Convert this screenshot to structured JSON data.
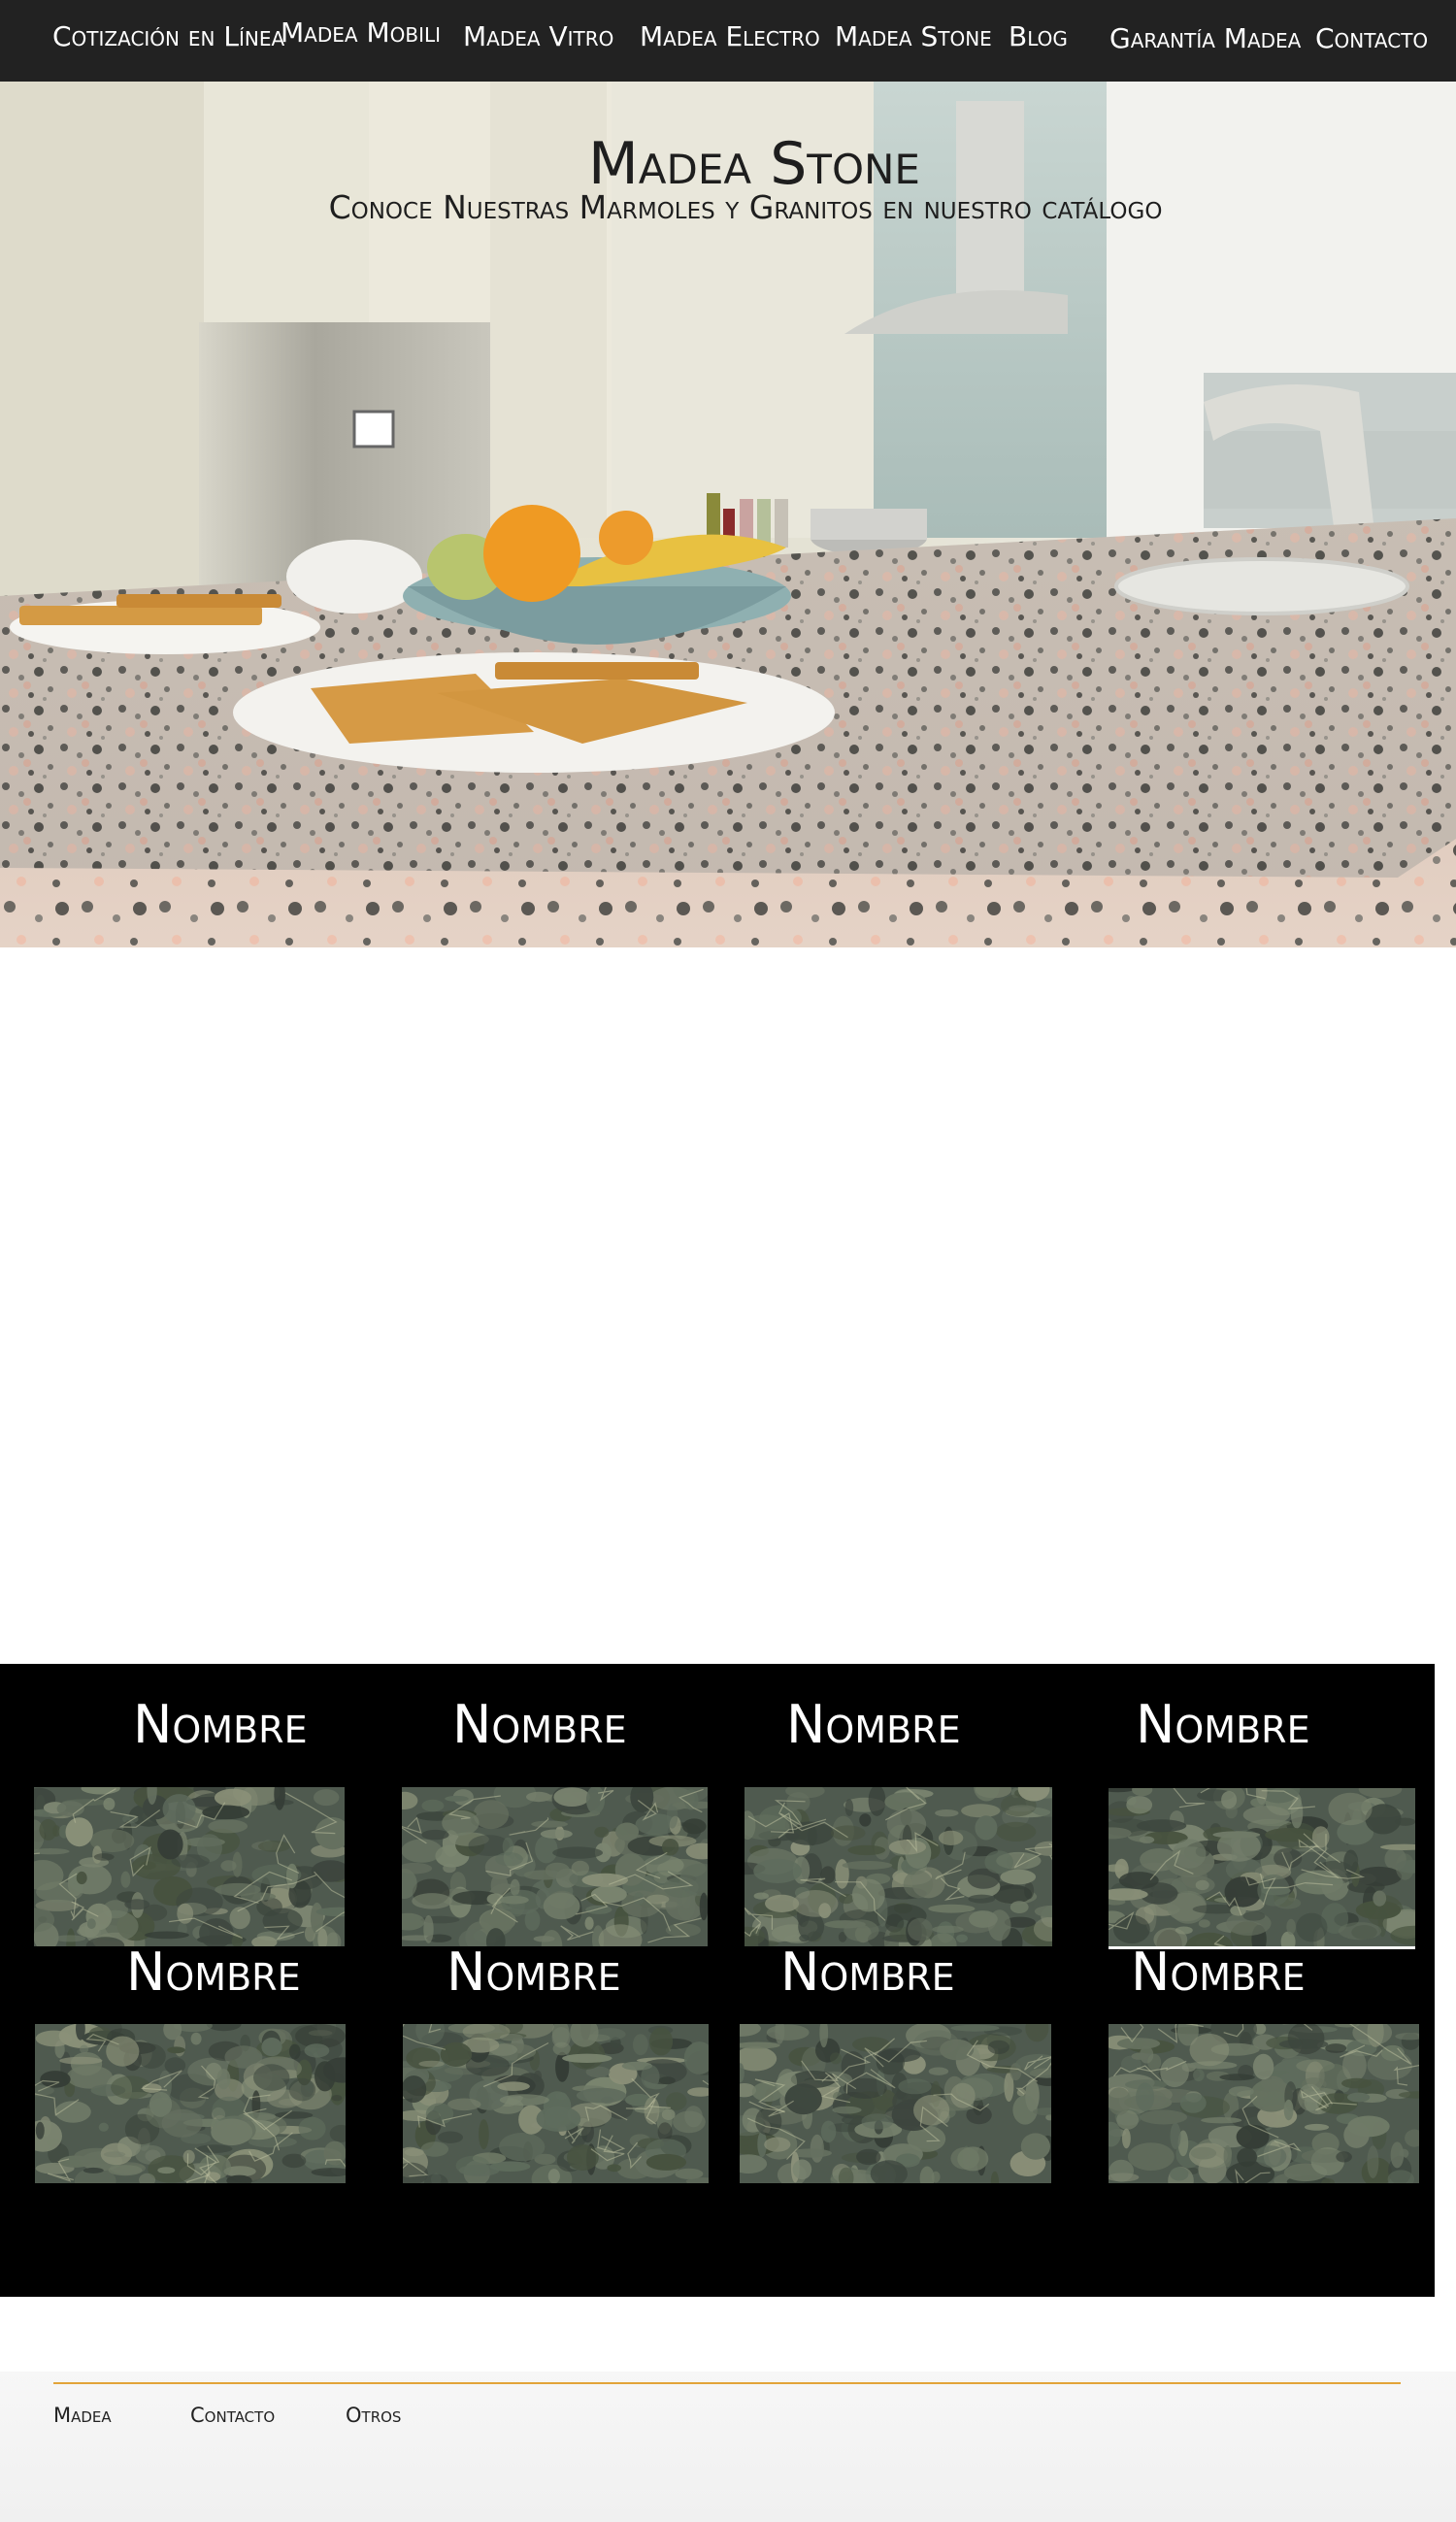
{
  "nav": {
    "items": [
      {
        "label": "Cotización en Línea"
      },
      {
        "label": "Madea Mobili"
      },
      {
        "label": "Madea Vitro"
      },
      {
        "label": "Madea Electro"
      },
      {
        "label": "Madea Stone"
      },
      {
        "label": "Blog"
      },
      {
        "label": "Garantía Madea"
      },
      {
        "label": "Contacto"
      }
    ]
  },
  "hero": {
    "title": "Madea Stone",
    "subtitle": "Conoce Nuestras  Marmoles y Granitos en nuestro catálogo"
  },
  "catalog": {
    "items": [
      {
        "name": "Nombre"
      },
      {
        "name": "Nombre"
      },
      {
        "name": "Nombre"
      },
      {
        "name": "Nombre"
      },
      {
        "name": "Nombre"
      },
      {
        "name": "Nombre"
      },
      {
        "name": "Nombre"
      },
      {
        "name": "Nombre"
      }
    ]
  },
  "footer": {
    "links": [
      {
        "label": "Madea"
      },
      {
        "label": "Contacto"
      },
      {
        "label": "Otros"
      }
    ]
  },
  "colors": {
    "nav_bg": "#222222",
    "catalog_bg": "#000000",
    "footer_accent": "#e2a439"
  }
}
